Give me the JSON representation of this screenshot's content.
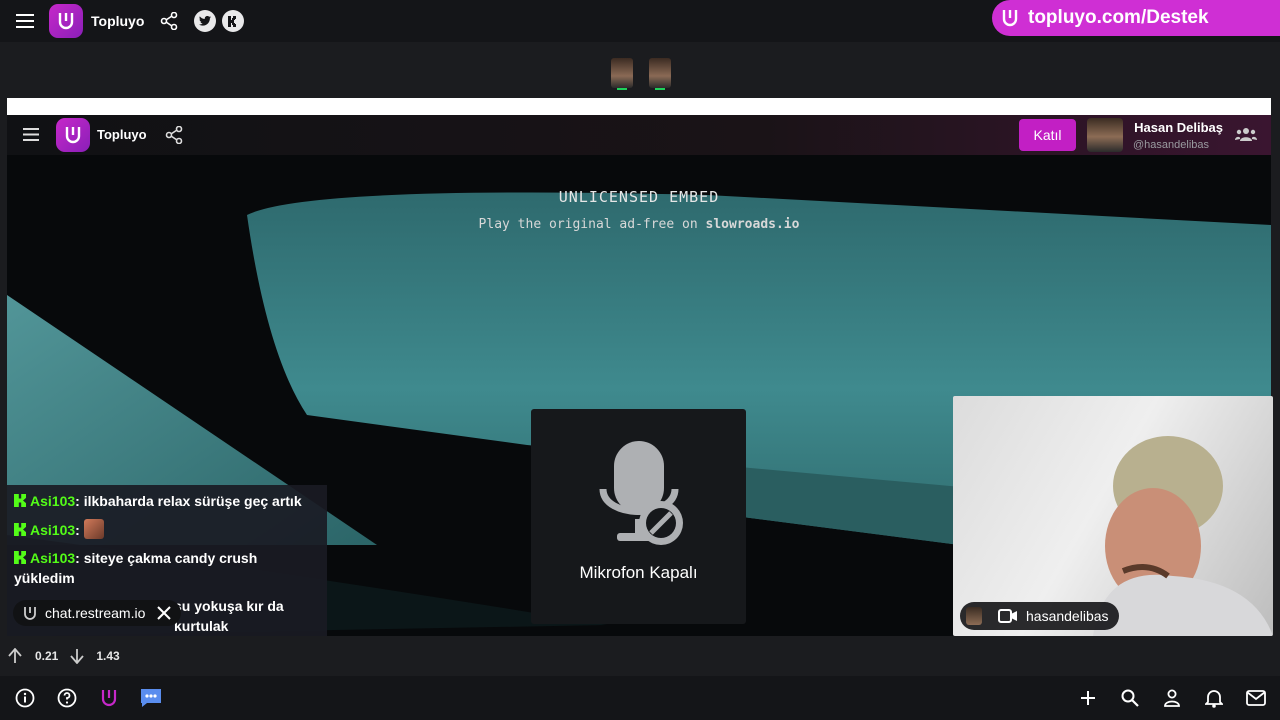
{
  "app": {
    "brand": "Topluyo",
    "promo_text": "topluyo.com/Destek"
  },
  "inner": {
    "brand": "Topluyo",
    "join_label": "Katıl",
    "host_name": "Hasan Delibaş",
    "host_handle": "@hasandelibas"
  },
  "game": {
    "embed_title": "UNLICENSED EMBED",
    "embed_sub_prefix": "Play the original ad-free on ",
    "embed_sub_site": "slowroads.io"
  },
  "mic": {
    "label": "Mikrofon Kapalı"
  },
  "chat": {
    "messages": [
      {
        "user": "Asi103",
        "text": "ilkbaharda relax sürüşe geç artık"
      },
      {
        "user": "Asi103",
        "text": ""
      },
      {
        "user": "Asi103",
        "text": "siteye çakma candy crush yükledim"
      },
      {
        "user": "",
        "text": "şu yokuşa kır da kurtulak"
      }
    ],
    "source_label": "chat.restream.io"
  },
  "camera": {
    "name": "hasandelibas"
  },
  "stats": {
    "upload": "0.21",
    "download": "1.43"
  },
  "colors": {
    "accent": "#c21fc4",
    "kick_green": "#53fc18"
  },
  "icons": {
    "top_left": [
      "menu-icon",
      "logo-icon",
      "share-icon",
      "twitter-icon",
      "kick-icon"
    ],
    "bottom_left": [
      "info-icon",
      "help-icon",
      "topluyo-icon",
      "chat-icon"
    ],
    "bottom_right": [
      "plus-icon",
      "search-icon",
      "user-icon",
      "bell-icon",
      "mail-icon"
    ]
  }
}
